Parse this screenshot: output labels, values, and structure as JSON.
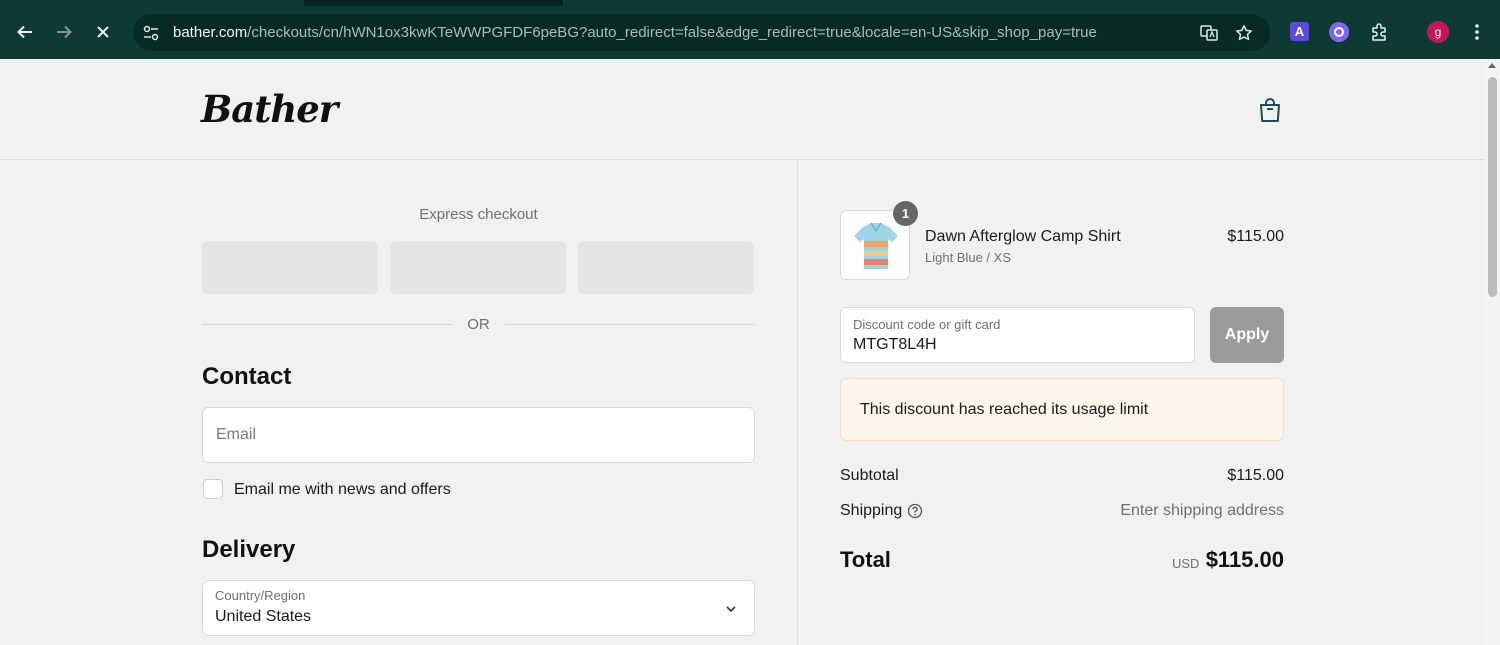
{
  "browser": {
    "url_host": "bather.com",
    "url_rest": "/checkouts/cn/hWN1ox3kwKTeWWPGFDF6peBG?auto_redirect=false&edge_redirect=true&locale=en-US&skip_shop_pay=true",
    "extension_a_label": "A",
    "avatar_letter": "g",
    "colors": {
      "chrome": "#0d3b34",
      "omnibox": "#082a25",
      "avatar": "#c2185b"
    }
  },
  "header": {
    "logo_text": "Bather"
  },
  "express": {
    "title": "Express checkout",
    "or_text": "OR"
  },
  "contact": {
    "heading": "Contact",
    "email_placeholder": "Email",
    "newsletter_label": "Email me with news and offers"
  },
  "delivery": {
    "heading": "Delivery",
    "country_label": "Country/Region",
    "country_value": "United States"
  },
  "order": {
    "item": {
      "quantity": "1",
      "name": "Dawn Afterglow Camp Shirt",
      "variant": "Light Blue / XS",
      "price": "$115.00"
    },
    "discount_label": "Discount code or gift card",
    "discount_value": "MTGT8L4H",
    "apply_label": "Apply",
    "notice": "This discount has reached its usage limit",
    "subtotal_label": "Subtotal",
    "subtotal_value": "$115.00",
    "shipping_label": "Shipping",
    "shipping_value": "Enter shipping address",
    "total_label": "Total",
    "total_currency": "USD",
    "total_value": "$115.00",
    "colors": {
      "notice_bg": "#fef5ea",
      "apply_disabled": "#9b9b9b",
      "bag_icon": "#1b4e62"
    }
  }
}
